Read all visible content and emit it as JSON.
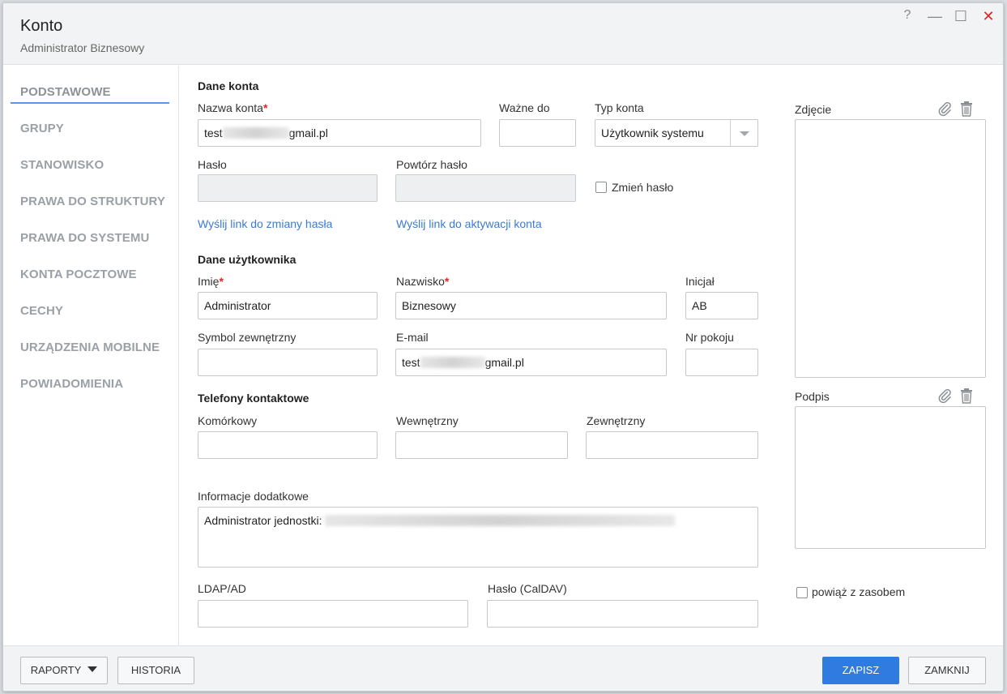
{
  "dialog": {
    "title": "Konto",
    "subtitle": "Administrator Biznesowy",
    "help_glyph": "?",
    "minimize_glyph": "—",
    "maximize_glyph": "☐",
    "close_glyph": "✕"
  },
  "sidebar": {
    "items": [
      {
        "label": "PODSTAWOWE",
        "active": true
      },
      {
        "label": "GRUPY"
      },
      {
        "label": "STANOWISKO"
      },
      {
        "label": "PRAWA DO STRUKTURY"
      },
      {
        "label": "PRAWA DO SYSTEMU"
      },
      {
        "label": "KONTA POCZTOWE"
      },
      {
        "label": "CECHY"
      },
      {
        "label": "URZĄDZENIA MOBILNE"
      },
      {
        "label": "POWIADOMIENIA"
      }
    ]
  },
  "account": {
    "section_title": "Dane konta",
    "name_label": "Nazwa konta",
    "name_prefix": "test",
    "name_suffix": "gmail.pl",
    "valid_until_label": "Ważne do",
    "valid_until_value": "",
    "type_label": "Typ konta",
    "type_value": "Użytkownik systemu",
    "password_label": "Hasło",
    "repeat_password_label": "Powtórz hasło",
    "change_password_label": "Zmień hasło",
    "change_password_checked": false,
    "reset_link": "Wyślij link do zmiany hasła",
    "activation_link": "Wyślij link do aktywacji konta"
  },
  "user": {
    "section_title": "Dane użytkownika",
    "first_name_label": "Imię",
    "first_name_value": "Administrator",
    "last_name_label": "Nazwisko",
    "last_name_value": "Biznesowy",
    "initials_label": "Inicjał",
    "initials_value": "AB",
    "external_symbol_label": "Symbol zewnętrzny",
    "email_label": "E-mail",
    "email_prefix": "test",
    "email_suffix": "gmail.pl",
    "room_label": "Nr pokoju"
  },
  "phones": {
    "section_title": "Telefony kontaktowe",
    "mobile_label": "Komórkowy",
    "internal_label": "Wewnętrzny",
    "external_label": "Zewnętrzny"
  },
  "extra": {
    "info_label": "Informacje dodatkowe",
    "info_prefix": "Administrator jednostki:",
    "ldap_label": "LDAP/AD",
    "caldav_label": "Hasło (CalDAV)"
  },
  "media": {
    "photo_label": "Zdjęcie",
    "signature_label": "Podpis",
    "link_resource_label": "powiąż z zasobem",
    "link_resource_checked": false
  },
  "footer": {
    "reports_label": "RAPORTY",
    "history_label": "HISTORIA",
    "save_label": "ZAPISZ",
    "close_label": "ZAMKNIJ"
  },
  "colors": {
    "accent": "#2f7be0",
    "link": "#3a7bd5",
    "required": "#d9262b",
    "nav_text": "#9aa0a6"
  }
}
